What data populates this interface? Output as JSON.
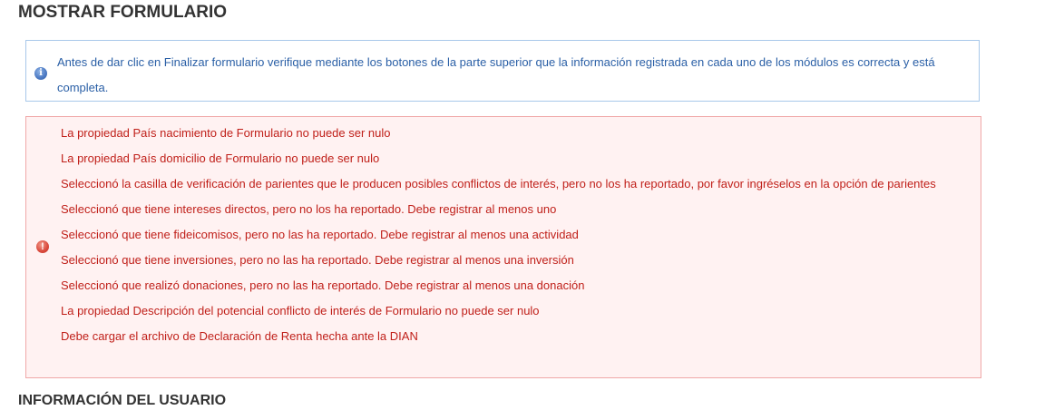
{
  "titles": {
    "main": "MOSTRAR FORMULARIO",
    "user": "INFORMACIÓN DEL USUARIO"
  },
  "info": {
    "icon": "info-icon",
    "text": "Antes de dar clic en Finalizar formulario verifique mediante los botones de la parte superior que la información registrada en cada uno de los módulos es correcta y está completa."
  },
  "errors": {
    "icon": "error-icon",
    "items": [
      "La propiedad País nacimiento de Formulario no puede ser nulo",
      "La propiedad País domicilio de Formulario no puede ser nulo",
      "Seleccionó la casilla de verificación de parientes que le producen posibles conflictos de interés, pero no los ha reportado, por favor ingréselos en la opción de parientes",
      "Seleccionó que tiene intereses directos, pero no los ha reportado. Debe registrar al menos uno",
      "Seleccionó que tiene fideicomisos, pero no las ha reportado. Debe registrar al menos una actividad",
      "Seleccionó que tiene inversiones, pero no las ha reportado. Debe registrar al menos una inversión",
      "Seleccionó que realizó donaciones, pero no las ha reportado. Debe registrar al menos una donación",
      "La propiedad Descripción del potencial conflicto de interés de Formulario no puede ser nulo",
      "Debe cargar el archivo de Declaración de Renta hecha ante la DIAN"
    ]
  },
  "colors": {
    "info_text": "#2a5fa6",
    "info_border": "#a8c8ea",
    "error_text": "#c0201a",
    "error_border": "#f0a8a8",
    "error_background": "#fff2f2"
  }
}
